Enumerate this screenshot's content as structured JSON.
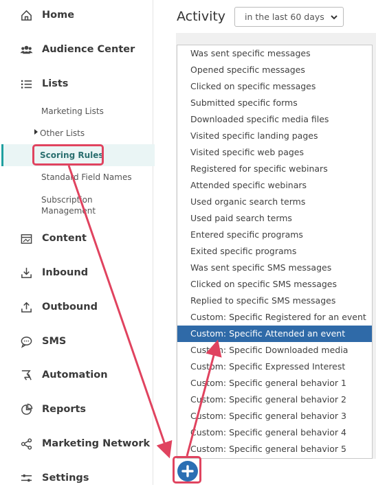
{
  "sidebar": {
    "items": [
      {
        "name": "sidebar-item-home",
        "icon": "home-icon",
        "label": "Home",
        "bold": true
      },
      {
        "name": "sidebar-item-audience-center",
        "icon": "audience-icon",
        "label": "Audience Center",
        "bold": true
      },
      {
        "name": "sidebar-item-lists",
        "icon": "list-icon",
        "label": "Lists",
        "bold": true
      },
      {
        "name": "sidebar-item-content",
        "icon": "content-icon",
        "label": "Content",
        "bold": true
      },
      {
        "name": "sidebar-item-inbound",
        "icon": "inbound-icon",
        "label": "Inbound",
        "bold": true
      },
      {
        "name": "sidebar-item-outbound",
        "icon": "outbound-icon",
        "label": "Outbound",
        "bold": true
      },
      {
        "name": "sidebar-item-sms",
        "icon": "chat-bubble-icon",
        "label": "SMS",
        "bold": true
      },
      {
        "name": "sidebar-item-automation",
        "icon": "automation-icon",
        "label": "Automation",
        "bold": true
      },
      {
        "name": "sidebar-item-reports",
        "icon": "pie-chart-icon",
        "label": "Reports",
        "bold": true
      },
      {
        "name": "sidebar-item-marketing-network",
        "icon": "share-icon",
        "label": "Marketing Network",
        "bold": true
      },
      {
        "name": "sidebar-item-settings",
        "icon": "sliders-icon",
        "label": "Settings",
        "bold": true
      }
    ],
    "lists_subitems": {
      "marketing_lists": "Marketing Lists",
      "other_lists": "Other Lists",
      "scoring_rules": "Scoring Rules",
      "standard_field_names": "Standard Field Names",
      "subscription_management_line1": "Subscription",
      "subscription_management_line2": "Management"
    }
  },
  "main": {
    "title": "Activity",
    "range_select": "in the last 60 days"
  },
  "dropdown": {
    "options": [
      "Was sent specific messages",
      "Opened specific messages",
      "Clicked on specific messages",
      "Submitted specific forms",
      "Downloaded specific media files",
      "Visited specific landing pages",
      "Visited specific web pages",
      "Registered for specific webinars",
      "Attended specific webinars",
      "Used organic search terms",
      "Used paid search terms",
      "Entered specific programs",
      "Exited specific programs",
      "Was sent specific SMS messages",
      "Clicked on specific SMS messages",
      "Replied to specific SMS messages",
      "Custom: Specific Registered for an event",
      "Custom: Specific Attended an event",
      "Custom: Specific Downloaded media",
      "Custom: Specific Expressed Interest",
      "Custom: Specific general behavior 1",
      "Custom: Specific general behavior 2",
      "Custom: Specific general behavior 3",
      "Custom: Specific general behavior 4",
      "Custom: Specific general behavior 5"
    ],
    "active_index": 17
  },
  "colors": {
    "accent": "#1fa0a0",
    "highlight": "#e0435f",
    "selection": "#2f6aa8",
    "add_button": "#2b6fb3"
  },
  "add_button_icon": "plus-icon"
}
